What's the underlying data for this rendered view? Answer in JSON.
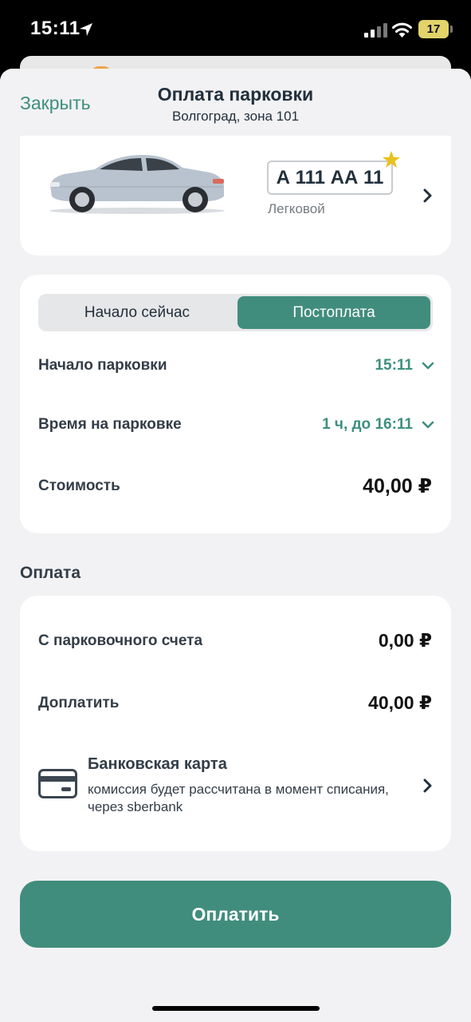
{
  "status_bar": {
    "time": "15:11",
    "battery": "17",
    "icons": [
      "location-arrow-icon",
      "cell-signal-icon",
      "wifi-icon",
      "battery-icon"
    ]
  },
  "header": {
    "close_label": "Закрыть",
    "title": "Оплата парковки",
    "subtitle": "Волгоград, зона 101"
  },
  "vehicle": {
    "plate": "А 111 АА 11",
    "type": "Легковой",
    "is_favorite": true
  },
  "parking": {
    "tabs": [
      "Начало сейчас",
      "Постоплата"
    ],
    "selected_tab": "Постоплата",
    "start_label": "Начало парковки",
    "start_value": "15:11",
    "duration_label": "Время на парковке",
    "duration_value": "1 ч, до 16:11",
    "cost_label": "Стоимость",
    "cost_value": "40,00 ₽"
  },
  "payment": {
    "section_title": "Оплата",
    "account_label": "С парковочного счета",
    "account_value": "0,00 ₽",
    "topup_label": "Доплатить",
    "topup_value": "40,00 ₽",
    "method_title": "Банковская карта",
    "method_desc": "комиссия будет рассчитана в момент списания, через sberbank"
  },
  "pay_button_label": "Оплатить",
  "colors": {
    "accent": "#418d7d",
    "accent_text": "#3d8f7e",
    "background": "#f2f2f4",
    "star": "#e8c21c"
  }
}
